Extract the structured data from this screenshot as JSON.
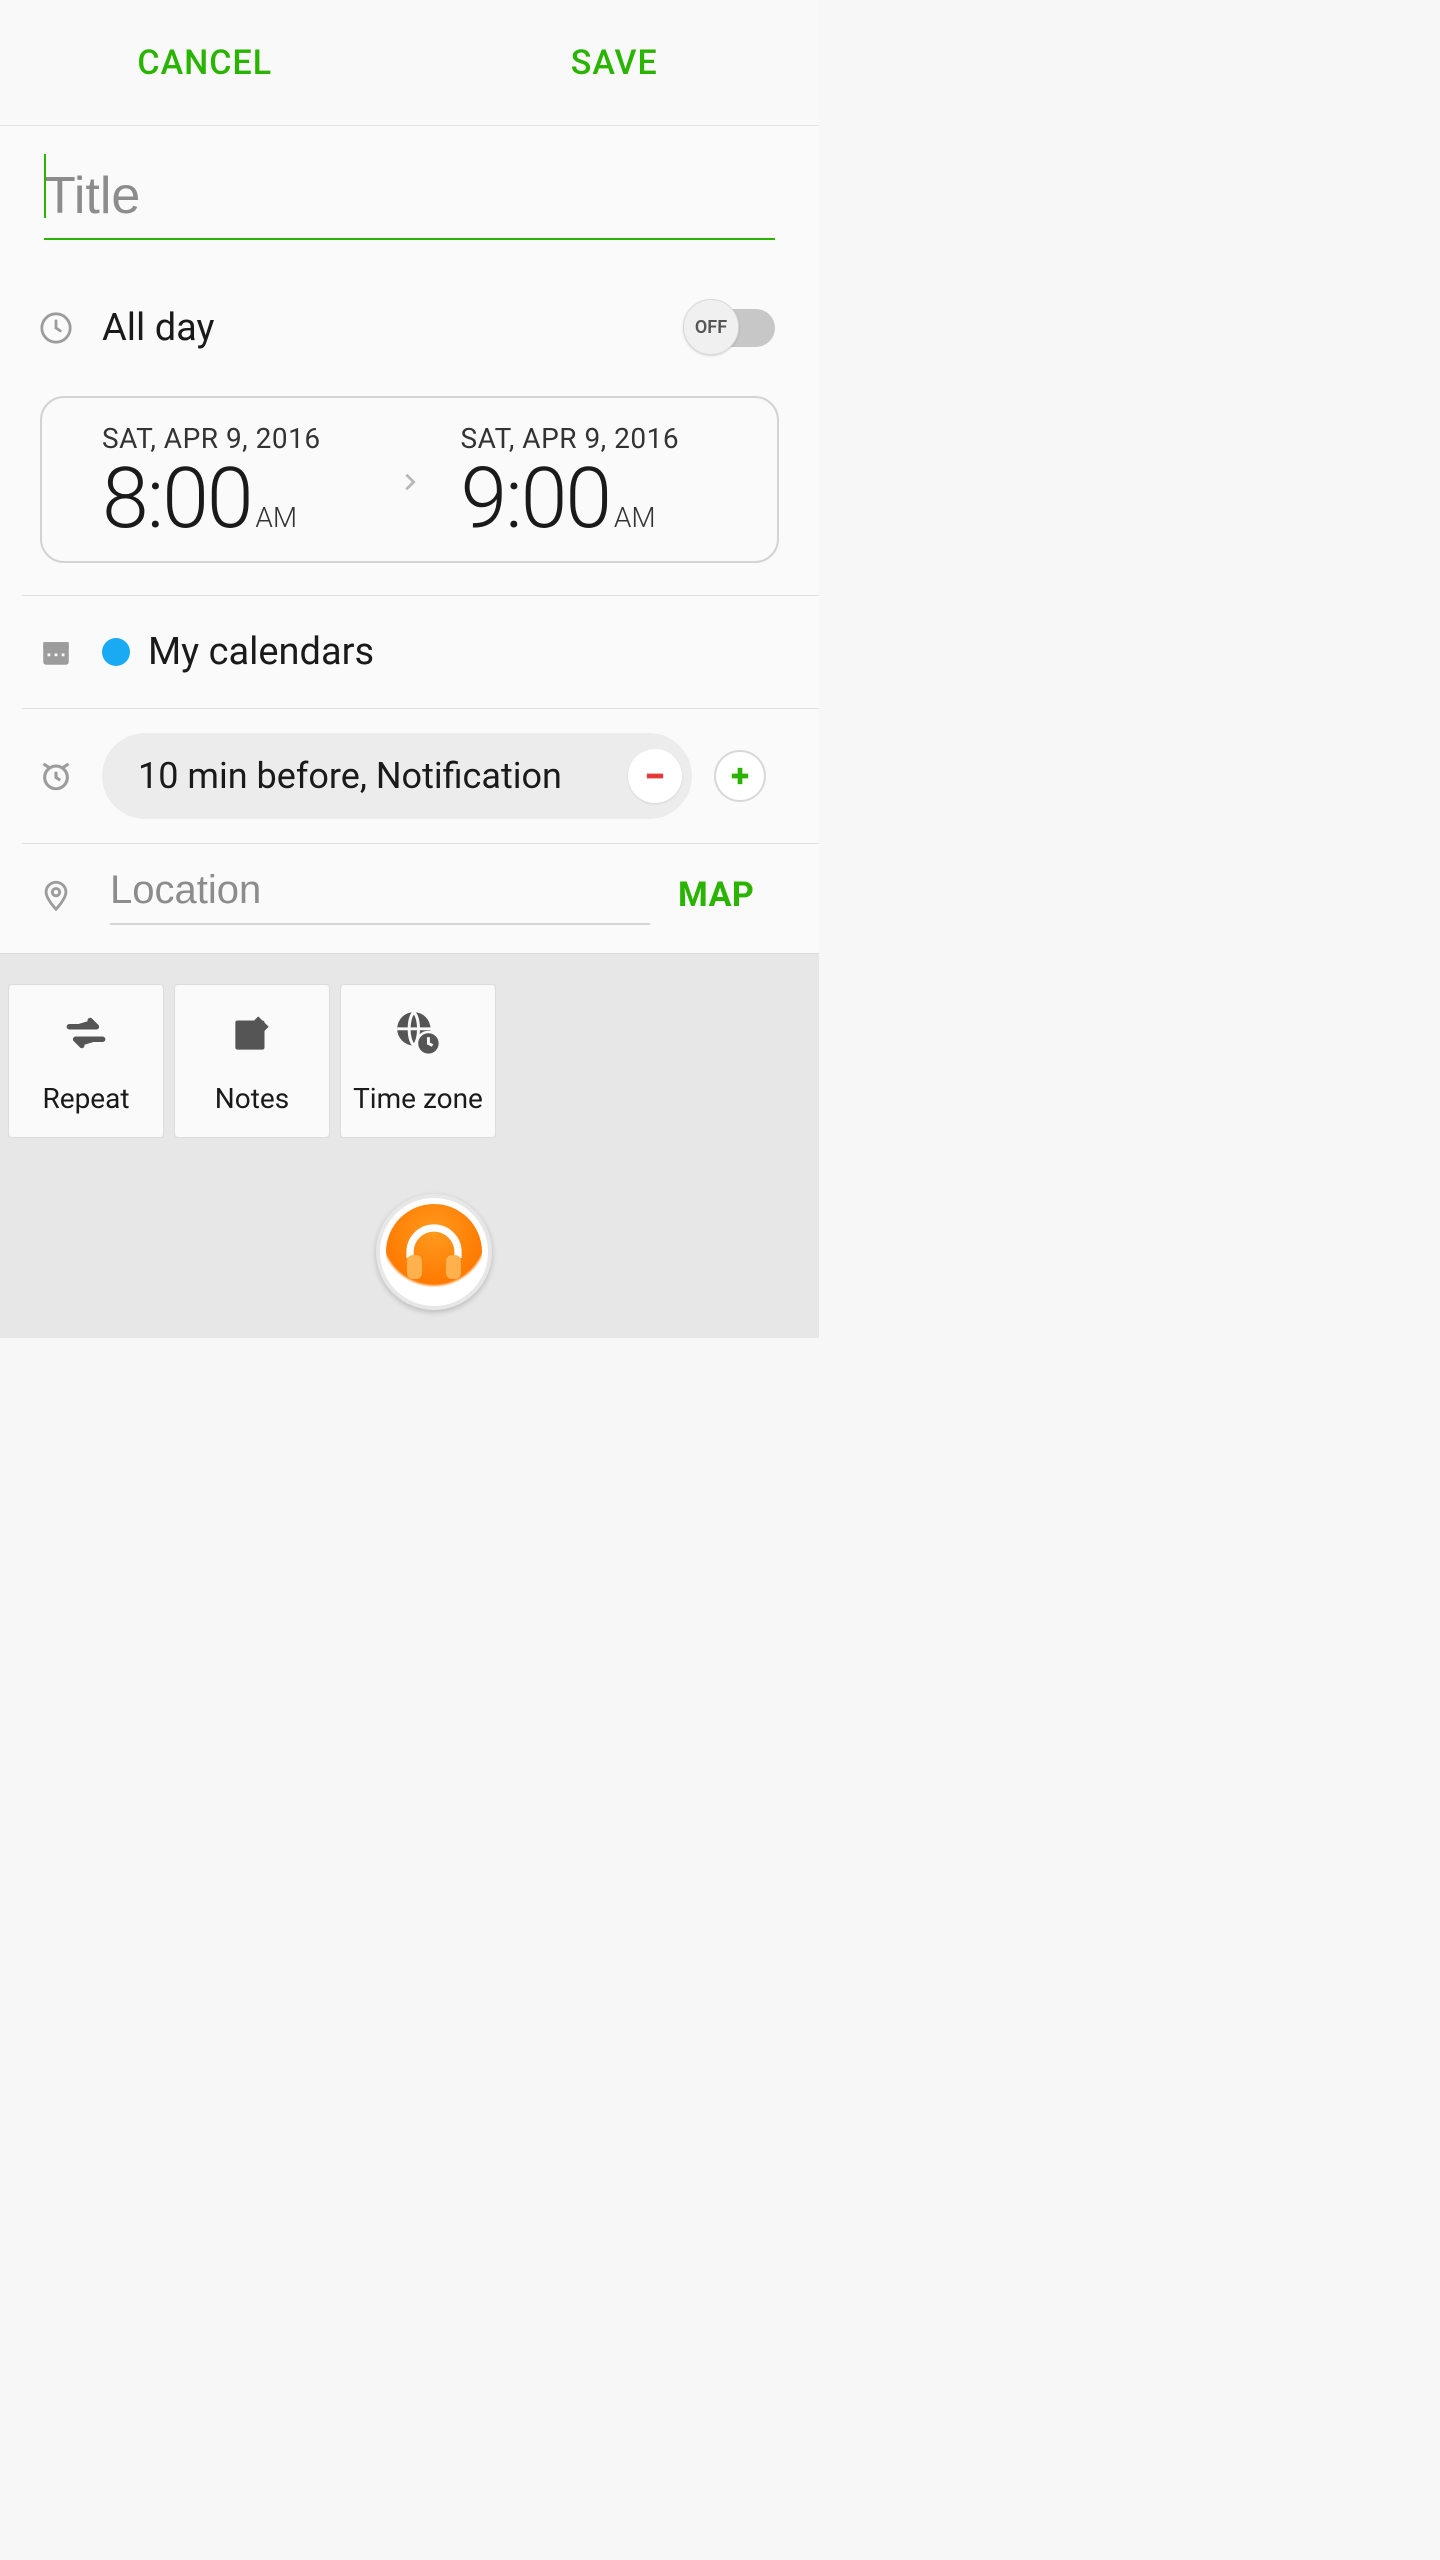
{
  "header": {
    "cancel_label": "CANCEL",
    "save_label": "SAVE"
  },
  "colors": {
    "accent": "#29b400",
    "calendar_dot": "#1aa9f3"
  },
  "title": {
    "placeholder": "Title",
    "value": ""
  },
  "all_day": {
    "label": "All day",
    "state_label": "OFF",
    "value": false
  },
  "time": {
    "start": {
      "date": "SAT, APR 9, 2016",
      "time": "8:00",
      "ampm": "AM"
    },
    "end": {
      "date": "SAT, APR 9, 2016",
      "time": "9:00",
      "ampm": "AM"
    }
  },
  "calendar": {
    "name": "My calendars"
  },
  "reminder": {
    "text": "10 min before, Notification"
  },
  "location": {
    "placeholder": "Location",
    "map_label": "MAP"
  },
  "tiles": {
    "repeat": "Repeat",
    "notes": "Notes",
    "timezone": "Time zone"
  }
}
